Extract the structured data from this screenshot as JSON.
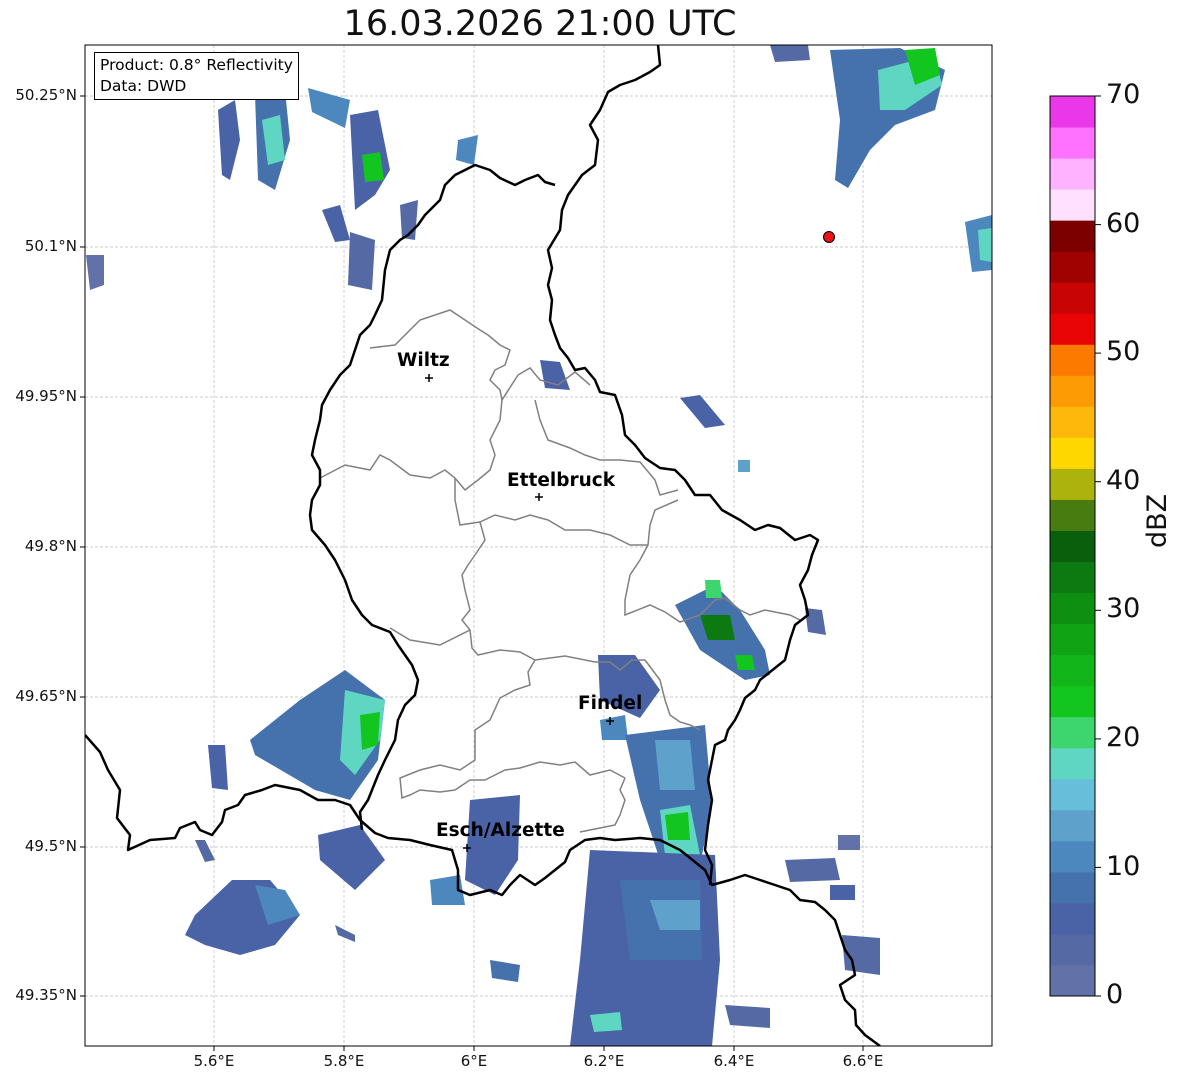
{
  "title": "16.03.2026 21:00 UTC",
  "info": {
    "product": "Product: 0.8° Reflectivity",
    "data": "Data: DWD"
  },
  "lat_labels": [
    "50.25°N",
    "50.1°N",
    "49.95°N",
    "49.8°N",
    "49.65°N",
    "49.5°N",
    "49.35°N"
  ],
  "lon_labels": [
    "5.6°E",
    "5.8°E",
    "6°E",
    "6.2°E",
    "6.4°E",
    "6.6°E"
  ],
  "cities": [
    {
      "name": "Wiltz",
      "lon": 5.933,
      "lat": 49.967
    },
    {
      "name": "Ettelbruck",
      "lon": 6.1,
      "lat": 49.848
    },
    {
      "name": "Findel",
      "lon": 6.211,
      "lat": 49.627
    },
    {
      "name": "Esch/Alzette",
      "lon": 5.983,
      "lat": 49.5
    }
  ],
  "radar_site": {
    "lon": 6.548,
    "lat": 50.11,
    "color": "#e8141a"
  },
  "colorbar": {
    "label": "dBZ",
    "min": 0,
    "max": 70,
    "ticks": [
      "0",
      "10",
      "20",
      "30",
      "40",
      "50",
      "60",
      "70"
    ],
    "colors": [
      "#6272a8",
      "#5569a4",
      "#4a63a6",
      "#4572ad",
      "#4c87bd",
      "#5ea2cb",
      "#66bedb",
      "#5fd6c2",
      "#3dd56e",
      "#13c51f",
      "#12b61b",
      "#10a415",
      "#0f8f12",
      "#0c7a10",
      "#095f0b",
      "#487b10",
      "#abb30c",
      "#fed600",
      "#fdb80b",
      "#fd9b04",
      "#fd7a00",
      "#e90505",
      "#c80404",
      "#a00101",
      "#7d0000",
      "#ffe0ff",
      "#ffb2ff",
      "#ff71ff",
      "#e937e9"
    ]
  },
  "colors": {
    "border": "#000000",
    "canton_border": "#808080",
    "grid": "#bbbbbb"
  }
}
